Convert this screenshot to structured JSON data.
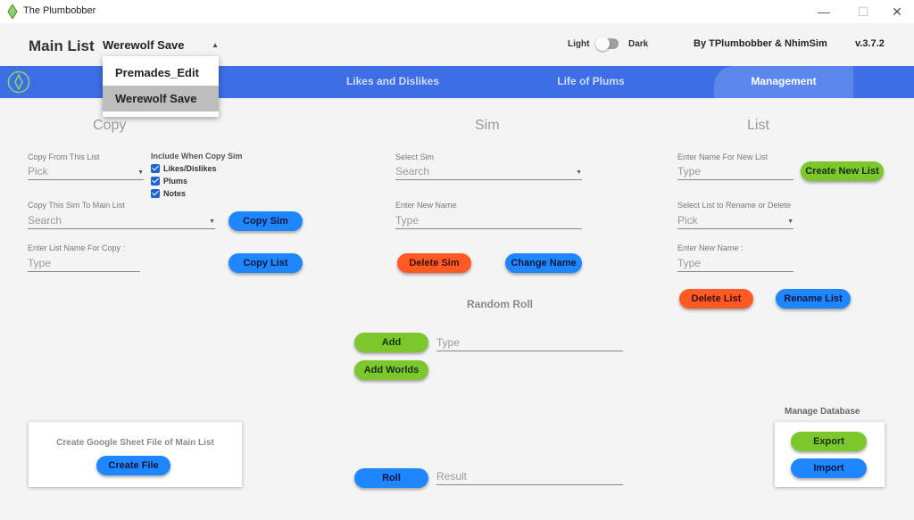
{
  "window": {
    "title": "The Plumbobber",
    "minimize": "—",
    "maximize": "☐",
    "close": "✕"
  },
  "header": {
    "main_list_label": "Main List",
    "main_list_value": "Werewolf Save",
    "theme_light": "Light",
    "theme_dark": "Dark",
    "credits": "By TPlumbobber & NhimSim",
    "version": "v.3.7.2"
  },
  "dropdown": {
    "options": [
      "Premades_Edit",
      "Werewolf Save"
    ],
    "selected": "Werewolf Save"
  },
  "nav": {
    "tabs": [
      "Likes and Dislikes",
      "Life of Plums",
      "Management"
    ],
    "active": "Management"
  },
  "copy": {
    "title": "Copy",
    "from_label": "Copy From This List",
    "from_placeholder": "Pick",
    "include_label": "Include When Copy Sim",
    "include_options": [
      "Likes/Dislikes",
      "Plums",
      "Notes"
    ],
    "to_main_label": "Copy This Sim To Main List",
    "to_main_placeholder": "Search",
    "copy_sim_button": "Copy Sim",
    "list_name_label": "Enter List Name For Copy :",
    "list_name_placeholder": "Type",
    "copy_list_button": "Copy List"
  },
  "sim": {
    "title": "Sim",
    "select_label": "Select Sim",
    "select_placeholder": "Search",
    "new_name_label": "Enter New Name",
    "new_name_placeholder": "Type",
    "delete_button": "Delete Sim",
    "change_button": "Change Name"
  },
  "list": {
    "title": "List",
    "new_list_label": "Enter Name For New List",
    "new_list_placeholder": "Type",
    "create_button": "Create New List",
    "rename_label": "Select List to Rename or Delete",
    "rename_placeholder": "Pick",
    "new_name_label": "Enter New Name :",
    "new_name_placeholder": "Type",
    "delete_button": "Delete List",
    "rename_button": "Rename List"
  },
  "random_roll": {
    "title": "Random Roll",
    "add_button": "Add",
    "add_placeholder": "Type",
    "add_worlds_button": "Add Worlds",
    "roll_button": "Roll",
    "result_placeholder": "Result"
  },
  "google_sheet": {
    "title": "Create Google Sheet File of Main List",
    "button": "Create File"
  },
  "database": {
    "title": "Manage Database",
    "export_button": "Export",
    "import_button": "Import"
  }
}
